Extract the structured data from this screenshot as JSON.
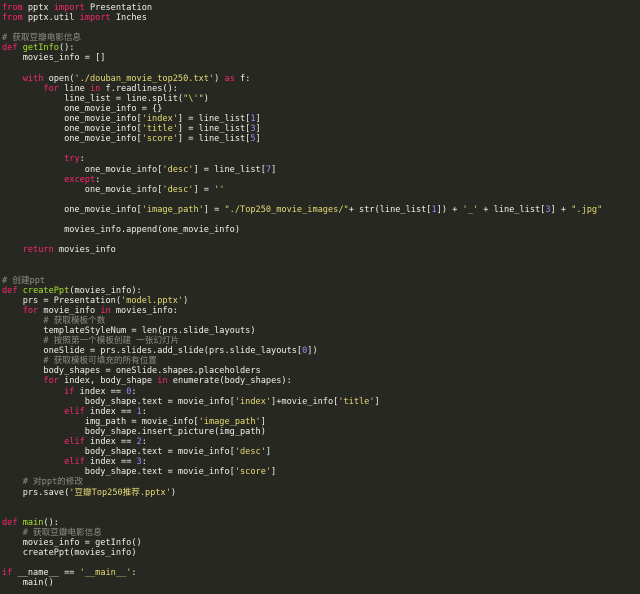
{
  "editor": {
    "colors": {
      "background": "#272822",
      "keyword": "#f92672",
      "function": "#a6e22e",
      "string": "#e6db74",
      "number": "#ae81ff",
      "comment": "#8f8f86",
      "plain": "#f1f1ea"
    },
    "lines": [
      [
        [
          "kw",
          "from"
        ],
        [
          "pl",
          " pptx "
        ],
        [
          "kw",
          "import"
        ],
        [
          "pl",
          " Presentation"
        ]
      ],
      [
        [
          "kw",
          "from"
        ],
        [
          "pl",
          " pptx.util "
        ],
        [
          "kw",
          "import"
        ],
        [
          "pl",
          " Inches"
        ]
      ],
      [],
      [
        [
          "cm",
          "# 获取豆瓣电影信息"
        ]
      ],
      [
        [
          "kw",
          "def"
        ],
        [
          "pl",
          " "
        ],
        [
          "fn",
          "getInfo"
        ],
        [
          "pl",
          "():"
        ]
      ],
      [
        [
          "pl",
          "    movies_info = []"
        ]
      ],
      [],
      [
        [
          "pl",
          "    "
        ],
        [
          "kw",
          "with"
        ],
        [
          "pl",
          " open("
        ],
        [
          "str",
          "'./douban_movie_top250.txt'"
        ],
        [
          "pl",
          ") "
        ],
        [
          "kw",
          "as"
        ],
        [
          "pl",
          " f:"
        ]
      ],
      [
        [
          "pl",
          "        "
        ],
        [
          "kw",
          "for"
        ],
        [
          "pl",
          " line "
        ],
        [
          "kw",
          "in"
        ],
        [
          "pl",
          " f.readlines():"
        ]
      ],
      [
        [
          "pl",
          "            line_list = line.split("
        ],
        [
          "str",
          "\"\\'\""
        ],
        [
          "pl",
          ")"
        ]
      ],
      [
        [
          "pl",
          "            one_movie_info = {}"
        ]
      ],
      [
        [
          "pl",
          "            one_movie_info["
        ],
        [
          "str",
          "'index'"
        ],
        [
          "pl",
          "] = line_list["
        ],
        [
          "num",
          "1"
        ],
        [
          "pl",
          "]"
        ]
      ],
      [
        [
          "pl",
          "            one_movie_info["
        ],
        [
          "str",
          "'title'"
        ],
        [
          "pl",
          "] = line_list["
        ],
        [
          "num",
          "3"
        ],
        [
          "pl",
          "]"
        ]
      ],
      [
        [
          "pl",
          "            one_movie_info["
        ],
        [
          "str",
          "'score'"
        ],
        [
          "pl",
          "] = line_list["
        ],
        [
          "num",
          "5"
        ],
        [
          "pl",
          "]"
        ]
      ],
      [],
      [
        [
          "pl",
          "            "
        ],
        [
          "kw",
          "try"
        ],
        [
          "pl",
          ":"
        ]
      ],
      [
        [
          "pl",
          "                one_movie_info["
        ],
        [
          "str",
          "'desc'"
        ],
        [
          "pl",
          "] = line_list["
        ],
        [
          "num",
          "7"
        ],
        [
          "pl",
          "]"
        ]
      ],
      [
        [
          "pl",
          "            "
        ],
        [
          "kw",
          "except"
        ],
        [
          "pl",
          ":"
        ]
      ],
      [
        [
          "pl",
          "                one_movie_info["
        ],
        [
          "str",
          "'desc'"
        ],
        [
          "pl",
          "] = "
        ],
        [
          "str",
          "''"
        ]
      ],
      [],
      [
        [
          "pl",
          "            one_movie_info["
        ],
        [
          "str",
          "'image_path'"
        ],
        [
          "pl",
          "] = "
        ],
        [
          "str",
          "\"./Top250_movie_images/\""
        ],
        [
          "pl",
          "+ str(line_list["
        ],
        [
          "num",
          "1"
        ],
        [
          "pl",
          "]) + "
        ],
        [
          "str",
          "'_'"
        ],
        [
          "pl",
          " + line_list["
        ],
        [
          "num",
          "3"
        ],
        [
          "pl",
          "] + "
        ],
        [
          "str",
          "\".jpg\""
        ]
      ],
      [],
      [
        [
          "pl",
          "            movies_info.append(one_movie_info)"
        ]
      ],
      [],
      [
        [
          "pl",
          "    "
        ],
        [
          "kw",
          "return"
        ],
        [
          "pl",
          " movies_info"
        ]
      ],
      [],
      [],
      [
        [
          "cm",
          "# 创建ppt"
        ]
      ],
      [
        [
          "kw",
          "def"
        ],
        [
          "pl",
          " "
        ],
        [
          "fn",
          "createPpt"
        ],
        [
          "pl",
          "(movies_info):"
        ]
      ],
      [
        [
          "pl",
          "    prs = Presentation("
        ],
        [
          "str",
          "'model.pptx'"
        ],
        [
          "pl",
          ")"
        ]
      ],
      [
        [
          "pl",
          "    "
        ],
        [
          "kw",
          "for"
        ],
        [
          "pl",
          " movie_info "
        ],
        [
          "kw",
          "in"
        ],
        [
          "pl",
          " movies_info:"
        ]
      ],
      [
        [
          "pl",
          "        "
        ],
        [
          "cm",
          "# 获取模板个数"
        ]
      ],
      [
        [
          "pl",
          "        templateStyleNum = len(prs.slide_layouts)"
        ]
      ],
      [
        [
          "pl",
          "        "
        ],
        [
          "cm",
          "# 按照第一个模板创建 一张幻灯片"
        ]
      ],
      [
        [
          "pl",
          "        oneSlide = prs.slides.add_slide(prs.slide_layouts["
        ],
        [
          "num",
          "0"
        ],
        [
          "pl",
          "])"
        ]
      ],
      [
        [
          "pl",
          "        "
        ],
        [
          "cm",
          "# 获取模板可填充的所有位置"
        ]
      ],
      [
        [
          "pl",
          "        body_shapes = oneSlide.shapes.placeholders"
        ]
      ],
      [
        [
          "pl",
          "        "
        ],
        [
          "kw",
          "for"
        ],
        [
          "pl",
          " index, body_shape "
        ],
        [
          "kw",
          "in"
        ],
        [
          "pl",
          " enumerate(body_shapes):"
        ]
      ],
      [
        [
          "pl",
          "            "
        ],
        [
          "kw",
          "if"
        ],
        [
          "pl",
          " index == "
        ],
        [
          "num",
          "0"
        ],
        [
          "pl",
          ":"
        ]
      ],
      [
        [
          "pl",
          "                body_shape.text = movie_info["
        ],
        [
          "str",
          "'index'"
        ],
        [
          "pl",
          "]+movie_info["
        ],
        [
          "str",
          "'title'"
        ],
        [
          "pl",
          "]"
        ]
      ],
      [
        [
          "pl",
          "            "
        ],
        [
          "kw",
          "elif"
        ],
        [
          "pl",
          " index == "
        ],
        [
          "num",
          "1"
        ],
        [
          "pl",
          ":"
        ]
      ],
      [
        [
          "pl",
          "                img_path = movie_info["
        ],
        [
          "str",
          "'image_path'"
        ],
        [
          "pl",
          "]"
        ]
      ],
      [
        [
          "pl",
          "                body_shape.insert_picture(img_path)"
        ]
      ],
      [
        [
          "pl",
          "            "
        ],
        [
          "kw",
          "elif"
        ],
        [
          "pl",
          " index == "
        ],
        [
          "num",
          "2"
        ],
        [
          "pl",
          ":"
        ]
      ],
      [
        [
          "pl",
          "                body_shape.text = movie_info["
        ],
        [
          "str",
          "'desc'"
        ],
        [
          "pl",
          "]"
        ]
      ],
      [
        [
          "pl",
          "            "
        ],
        [
          "kw",
          "elif"
        ],
        [
          "pl",
          " index == "
        ],
        [
          "num",
          "3"
        ],
        [
          "pl",
          ":"
        ]
      ],
      [
        [
          "pl",
          "                body_shape.text = movie_info["
        ],
        [
          "str",
          "'score'"
        ],
        [
          "pl",
          "]"
        ]
      ],
      [
        [
          "pl",
          "    "
        ],
        [
          "cm",
          "# 对ppt的修改"
        ]
      ],
      [
        [
          "pl",
          "    prs.save("
        ],
        [
          "str",
          "'豆瓣Top250推荐.pptx'"
        ],
        [
          "pl",
          ")"
        ]
      ],
      [],
      [],
      [
        [
          "kw",
          "def"
        ],
        [
          "pl",
          " "
        ],
        [
          "fn",
          "main"
        ],
        [
          "pl",
          "():"
        ]
      ],
      [
        [
          "pl",
          "    "
        ],
        [
          "cm",
          "# 获取豆瓣电影信息"
        ]
      ],
      [
        [
          "pl",
          "    movies_info = getInfo()"
        ]
      ],
      [
        [
          "pl",
          "    createPpt(movies_info)"
        ]
      ],
      [],
      [
        [
          "kw",
          "if"
        ],
        [
          "pl",
          " __name__ == "
        ],
        [
          "str",
          "'__main__'"
        ],
        [
          "pl",
          ":"
        ]
      ],
      [
        [
          "pl",
          "    main()"
        ]
      ]
    ]
  }
}
